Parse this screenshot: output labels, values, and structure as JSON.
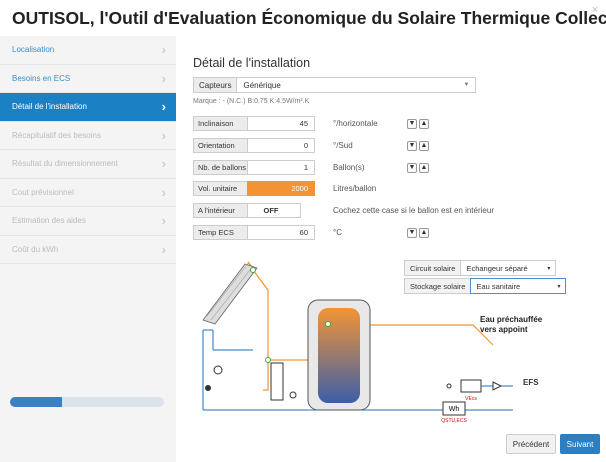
{
  "app": {
    "title": "OUTISOL, l'Outil d'Evaluation Économique du Solaire Thermique Collectif",
    "close": "×"
  },
  "sidebar": {
    "items": [
      {
        "label": "Localisation",
        "state": "done"
      },
      {
        "label": "Besoins en ECS",
        "state": "done"
      },
      {
        "label": "Détail de l'installation",
        "state": "active"
      },
      {
        "label": "Récapitulatif des besoins",
        "state": "todo"
      },
      {
        "label": "Résultat du dimensionnement",
        "state": "todo"
      },
      {
        "label": "Cout prévisionnel",
        "state": "todo"
      },
      {
        "label": "Estimation des aides",
        "state": "todo"
      },
      {
        "label": "Coût du kWh",
        "state": "todo"
      }
    ],
    "progress": 0.34
  },
  "main": {
    "title": "Détail de l'installation",
    "capteurs": {
      "label": "Capteurs",
      "value": "Générique"
    },
    "marque": "Marque : - (N.C.) B:0.75 K:4.5W/m².K",
    "fields": {
      "inclinaison": {
        "label": "Inclinaison",
        "value": "45",
        "unit": "°/horizontale"
      },
      "orientation": {
        "label": "Orientation",
        "value": "0",
        "unit": "°/Sud"
      },
      "ballons": {
        "label": "Nb. de ballons",
        "value": "1",
        "unit": "Ballon(s)"
      },
      "vol": {
        "label": "Vol. unitaire",
        "value": "2000",
        "unit": "Litres/ballon"
      },
      "interieur": {
        "label": "A l'intérieur",
        "value": "OFF",
        "note": "Cochez cette case si le ballon est en intérieur"
      },
      "temp": {
        "label": "Temp ECS",
        "value": "60",
        "unit": "°C"
      }
    }
  },
  "diagram": {
    "circuit": {
      "label": "Circuit solaire",
      "value": "Echangeur séparé"
    },
    "stockage": {
      "label": "Stockage solaire",
      "value": "Eau sanitaire"
    },
    "eau_line1": "Eau préchauffée",
    "eau_line2": "vers appoint",
    "efs": "EFS",
    "vecs": "VEcs",
    "wh": "Wh",
    "qstu": "QSTU,ECS"
  },
  "buttons": {
    "prev": "Précédent",
    "next": "Suivant"
  },
  "colors": {
    "accent": "#1c80c4",
    "orange": "#f39434"
  }
}
